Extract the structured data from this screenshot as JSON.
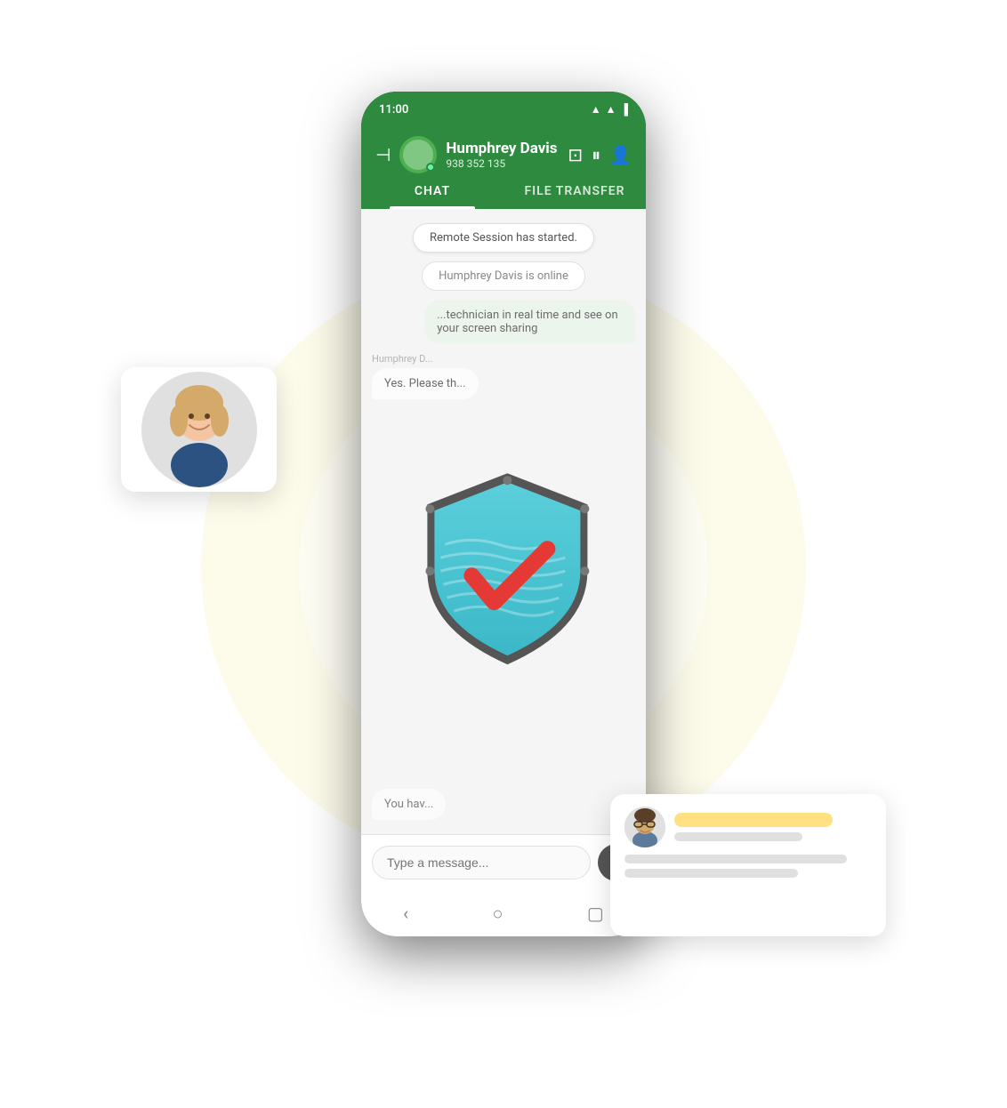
{
  "statusBar": {
    "time": "11:00",
    "icons": "▲▲▐"
  },
  "header": {
    "name": "Humphrey Davis",
    "number": "938 352 135",
    "backIcon": "⊣",
    "profileIcon": "◉",
    "onlineStatus": "online"
  },
  "tabs": [
    {
      "label": "CHAT",
      "active": true
    },
    {
      "label": "FILE TRANSFER",
      "active": false
    }
  ],
  "chat": {
    "systemMsg": "Remote Session has started.",
    "statusMsg": "Humphrey Davis is online",
    "bubbles": [
      {
        "type": "right",
        "text": "...technician in real time and see on your screen sharing"
      },
      {
        "type": "name-label",
        "text": "Humphrey D..."
      },
      {
        "type": "left",
        "text": "Yes. Please th..."
      },
      {
        "type": "bottom-msg",
        "text": "You hav..."
      }
    ]
  },
  "inputBar": {
    "placeholder": "Type a message...",
    "sendIcon": "➤"
  },
  "navBar": {
    "backIcon": "‹",
    "homeIcon": "○",
    "recentIcon": "▢"
  },
  "shield": {
    "label": "security-shield"
  },
  "floatingAvatar": {
    "label": "user-avatar-female"
  },
  "floatingChat": {
    "label": "chat-preview-card"
  }
}
